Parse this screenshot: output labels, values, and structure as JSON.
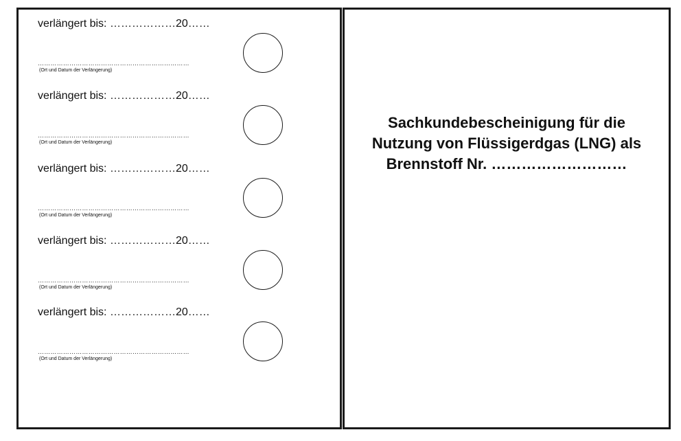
{
  "left_panel": {
    "entries": [
      {
        "extended_label": "verlängert bis: ………………20……",
        "signature_dots": "………………………………………………………………",
        "signature_caption": "(Ort und Datum der Verlängerung)"
      },
      {
        "extended_label": "verlängert bis: ………………20……",
        "signature_dots": "………………………………………………………………",
        "signature_caption": "(Ort und Datum der Verlängerung)"
      },
      {
        "extended_label": "verlängert bis: ………………20……",
        "signature_dots": "………………………………………………………………",
        "signature_caption": "(Ort und Datum der Verlängerung)"
      },
      {
        "extended_label": "verlängert bis: ………………20……",
        "signature_dots": "………………………………………………………………",
        "signature_caption": "(Ort und Datum der Verlängerung)"
      },
      {
        "extended_label": "verlängert bis: ………………20……",
        "signature_dots": "………………………………………………………………",
        "signature_caption": "(Ort und Datum der Verlängerung)"
      }
    ]
  },
  "right_panel": {
    "title_line_1": "Sachkundebescheinigung für die",
    "title_line_2": "Nutzung von Flüssigerdgas (LNG) als",
    "title_line_3": "Brennstoff Nr. ………………………"
  }
}
